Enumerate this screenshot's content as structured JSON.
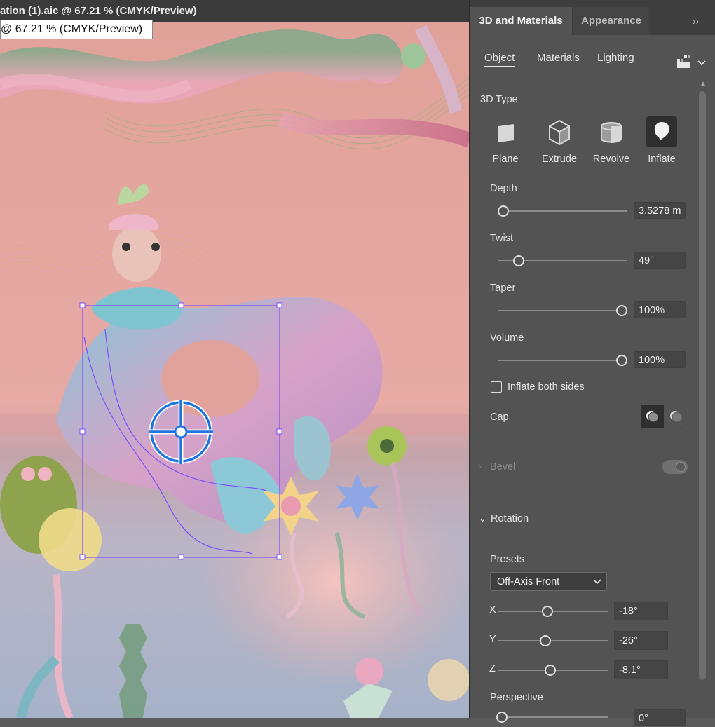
{
  "document": {
    "tab_title": "ation (1).aic @ 67.21 % (CMYK/Preview)",
    "tooltip": "@ 67.21 % (CMYK/Preview)"
  },
  "panel": {
    "tabs": [
      "3D and Materials",
      "Appearance"
    ],
    "collapse_icon": "double-chevron-right",
    "subtabs": [
      "Object",
      "Materials",
      "Lighting"
    ],
    "active_subtab": "Object",
    "section_3d_type": "3D Type",
    "types": [
      {
        "label": "Plane",
        "icon": "plane-icon"
      },
      {
        "label": "Extrude",
        "icon": "extrude-icon"
      },
      {
        "label": "Revolve",
        "icon": "revolve-icon"
      },
      {
        "label": "Inflate",
        "icon": "inflate-icon"
      }
    ],
    "selected_type": "Inflate",
    "sliders": [
      {
        "label": "Depth",
        "value": "3.5278 m",
        "level": 0.0
      },
      {
        "label": "Twist",
        "value": "49°",
        "level": 0.16
      },
      {
        "label": "Taper",
        "value": "100%",
        "level": 1.0
      },
      {
        "label": "Volume",
        "value": "100%",
        "level": 1.0
      }
    ],
    "inflate_both_sides": {
      "label": "Inflate both sides",
      "checked": false
    },
    "cap_label": "Cap",
    "bevel": {
      "label": "Bevel",
      "enabled": false
    },
    "rotation": {
      "label": "Rotation",
      "presets_label": "Presets",
      "preset_value": "Off-Axis Front",
      "axes": [
        {
          "axis": "X",
          "value": "-18°",
          "level": 0.45
        },
        {
          "axis": "Y",
          "value": "-26°",
          "level": 0.43
        },
        {
          "axis": "Z",
          "value": "-8.1°",
          "level": 0.47
        }
      ],
      "perspective_label": "Perspective",
      "perspective_value": "0°"
    }
  },
  "colors": {
    "panel_bg": "#535353",
    "selection": "#7b4dff",
    "widget_blue": "#1f74e0"
  }
}
